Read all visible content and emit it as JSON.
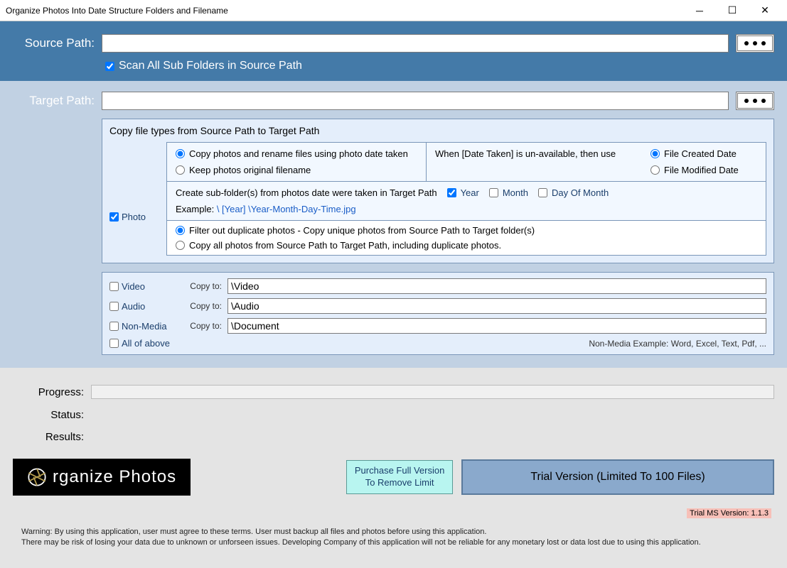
{
  "window": {
    "title": "Organize Photos Into Date Structure Folders and Filename"
  },
  "source": {
    "label": "Source Path:",
    "value": "",
    "browse": "•••",
    "scan_sub": "Scan All Sub Folders in Source Path"
  },
  "target": {
    "label": "Target Path:",
    "value": "",
    "fieldset_title": "Copy file types from Source Path to Target Path",
    "photo_label": "Photo",
    "rename_opt": "Copy photos and rename files using photo date taken",
    "keep_opt": "Keep photos original filename",
    "when_unavail": "When [Date Taken] is un-available, then use",
    "file_created": "File Created Date",
    "file_modified": "File Modified Date",
    "subfolder_text": "Create sub-folder(s) from photos date were taken in Target Path",
    "year": "Year",
    "month": "Month",
    "day": "Day Of Month",
    "example_label": "Example:",
    "example_path": "\\ [Year] \\Year-Month-Day-Time.jpg",
    "filter_dup": "Filter out duplicate photos - Copy unique photos from Source Path to Target folder(s)",
    "copy_all": "Copy all photos from Source Path to Target Path, including duplicate photos."
  },
  "media": {
    "video": {
      "label": "Video",
      "copyto": "Copy to:",
      "value": "\\Video"
    },
    "audio": {
      "label": "Audio",
      "copyto": "Copy to:",
      "value": "\\Audio"
    },
    "nonmedia": {
      "label": "Non-Media",
      "copyto": "Copy to:",
      "value": "\\Document"
    },
    "all": {
      "label": "All of above"
    },
    "note": "Non-Media Example: Word, Excel, Text, Pdf, ..."
  },
  "status": {
    "progress": "Progress:",
    "status": "Status:",
    "results": "Results:"
  },
  "logo": {
    "text": "rganize Photos"
  },
  "buttons": {
    "purchase": "Purchase Full Version\nTo Remove Limit",
    "trial": "Trial Version (Limited To 100 Files)"
  },
  "version": "Trial MS Version: 1.1.3",
  "disclaimer1": "Warning:  By using this application, user must agree to these terms.  User must backup all files and photos before using this application.",
  "disclaimer2": "There may be risk of losing your data due to unknown or unforseen issues.  Developing Company of this application will not be reliable for any monetary lost or data lost due to using this application."
}
